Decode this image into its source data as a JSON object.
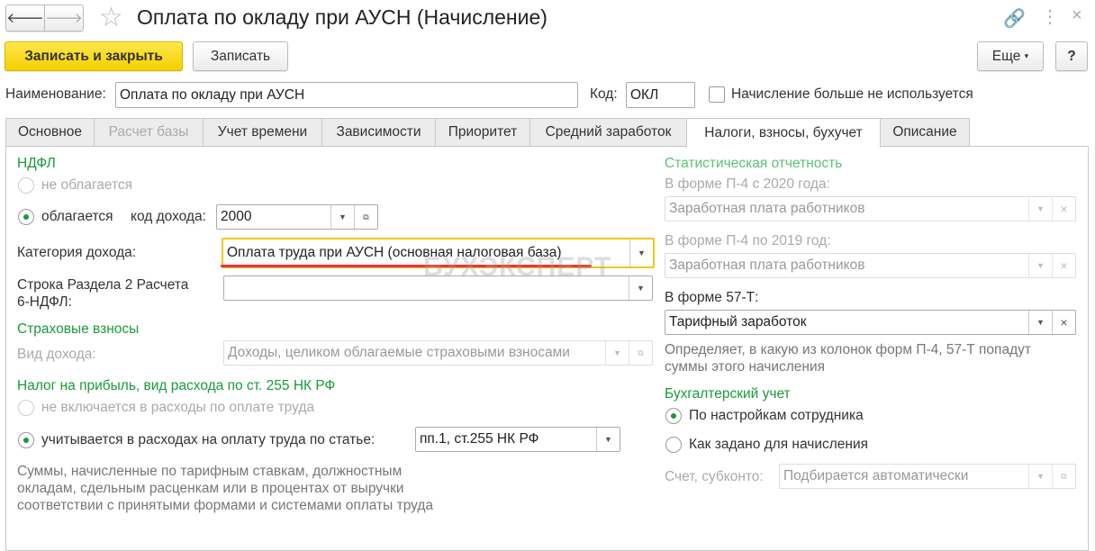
{
  "title": "Оплата по окладу при АУСН (Начисление)",
  "toolbar": {
    "save_close": "Записать и закрыть",
    "save": "Записать",
    "more": "Еще",
    "help": "?"
  },
  "name_label": "Наименование:",
  "name_value": "Оплата по окладу при АУСН",
  "code_label": "Код:",
  "code_value": "ОКЛ",
  "unused_label": "Начисление больше не используется",
  "tabs": [
    "Основное",
    "Расчет базы",
    "Учет времени",
    "Зависимости",
    "Приоритет",
    "Средний заработок",
    "Налоги, взносы, бухучет",
    "Описание"
  ],
  "ndfl": {
    "title": "НДФЛ",
    "not_taxed": "не облагается",
    "taxed": "облагается",
    "code_label": "код дохода:",
    "code_value": "2000",
    "category_label": "Категория дохода:",
    "category_value": "Оплата труда при АУСН (основная налоговая база)",
    "row_label_1": "Строка Раздела 2 Расчета",
    "row_label_2": "6-НДФЛ:",
    "row_value": ""
  },
  "insurance": {
    "title": "Страховые взносы",
    "kind_label": "Вид дохода:",
    "kind_value": "Доходы, целиком облагаемые страховыми взносами"
  },
  "profit": {
    "title": "Налог на прибыль, вид расхода по ст. 255 НК РФ",
    "not_included": "не включается в расходы по оплате труда",
    "included": "учитывается в расходах на оплату труда по статье:",
    "article_value": "пп.1, ст.255 НК РФ",
    "note_1": "Суммы, начисленные по тарифным ставкам, должностным",
    "note_2": "окладам, сдельным расценкам или в процентах от выручки",
    "note_3": "соответствии с принятыми формами и системами оплаты труда"
  },
  "stats": {
    "title": "Статистическая отчетность",
    "p4_2020_label": "В форме П-4 с 2020 года:",
    "p4_2020_value": "Заработная плата работников",
    "p4_2019_label": "В форме П-4 по 2019 год:",
    "p4_2019_value": "Заработная плата работников",
    "f57_label": "В форме 57-Т:",
    "f57_value": "Тарифный заработок",
    "note_1": "Определяет, в какую из колонок форм П-4, 57-Т попадут",
    "note_2": "суммы этого начисления"
  },
  "accounting": {
    "title": "Бухгалтерский учет",
    "by_employee": "По настройкам сотрудника",
    "as_set": "Как задано для начисления",
    "account_label": "Счет, субконто:",
    "account_value": "Подбирается автоматически"
  },
  "watermark": "БУХЭКСПЕРТ"
}
